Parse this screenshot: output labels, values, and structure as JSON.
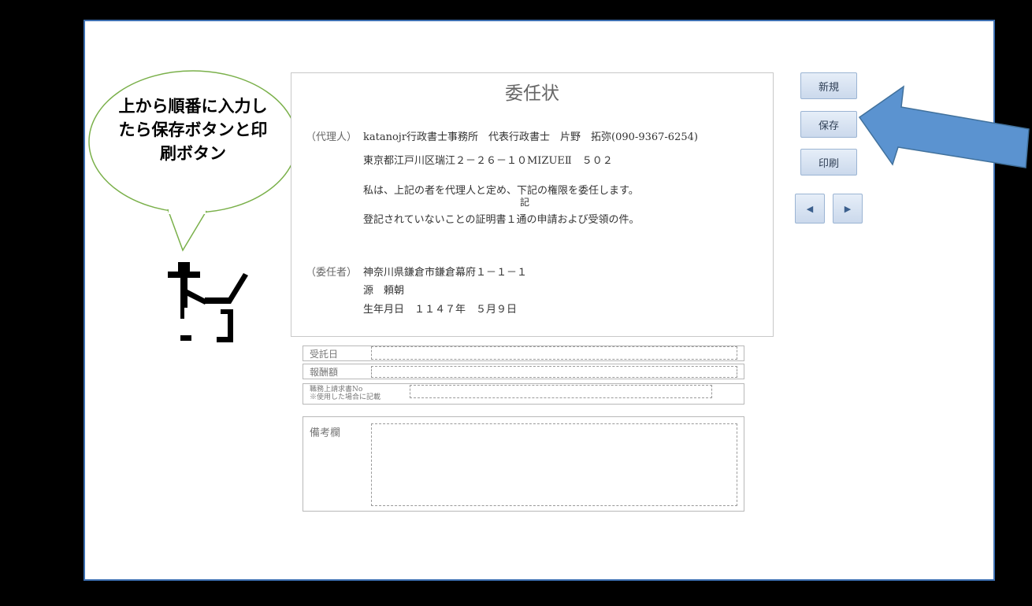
{
  "document": {
    "title": "委任状",
    "agent": {
      "label": "（代理人）",
      "line1": "katanojr行政書士事務所　代表行政書士　片野　拓弥(090-9367-6254)",
      "line2": "東京都江戸川区瑞江２－２６－１０MIZUEⅡ　５０２"
    },
    "statement": "私は、上記の者を代理人と定め、下記の権限を委任します。",
    "ki": "記",
    "matter": "登記されていないことの証明書１通の申請および受領の件。",
    "principal": {
      "label": "（委任者）",
      "address": "神奈川県鎌倉市鎌倉幕府１－１－１",
      "name": "源　頼朝",
      "birth": "生年月日　１１４７年　５月９日"
    }
  },
  "fields": {
    "received_date": {
      "label": "受託日",
      "value": ""
    },
    "fee": {
      "label": "報酬額",
      "value": ""
    },
    "invoice_no": {
      "label_line1": "職務上請求書No",
      "label_line2": "※使用した場合に記載",
      "value": ""
    },
    "remarks": {
      "label": "備考欄",
      "value": ""
    }
  },
  "buttons": {
    "new": "新規",
    "save": "保存",
    "print": "印刷",
    "prev": "◀",
    "next": "▶"
  },
  "annotation": {
    "bubble_text": "上から順番に入力したら保存ボタンと印刷ボタン",
    "colors": {
      "arrow": "#5b93d0",
      "bubble_border": "#7ab04a",
      "frame": "#3d6fb1"
    }
  }
}
